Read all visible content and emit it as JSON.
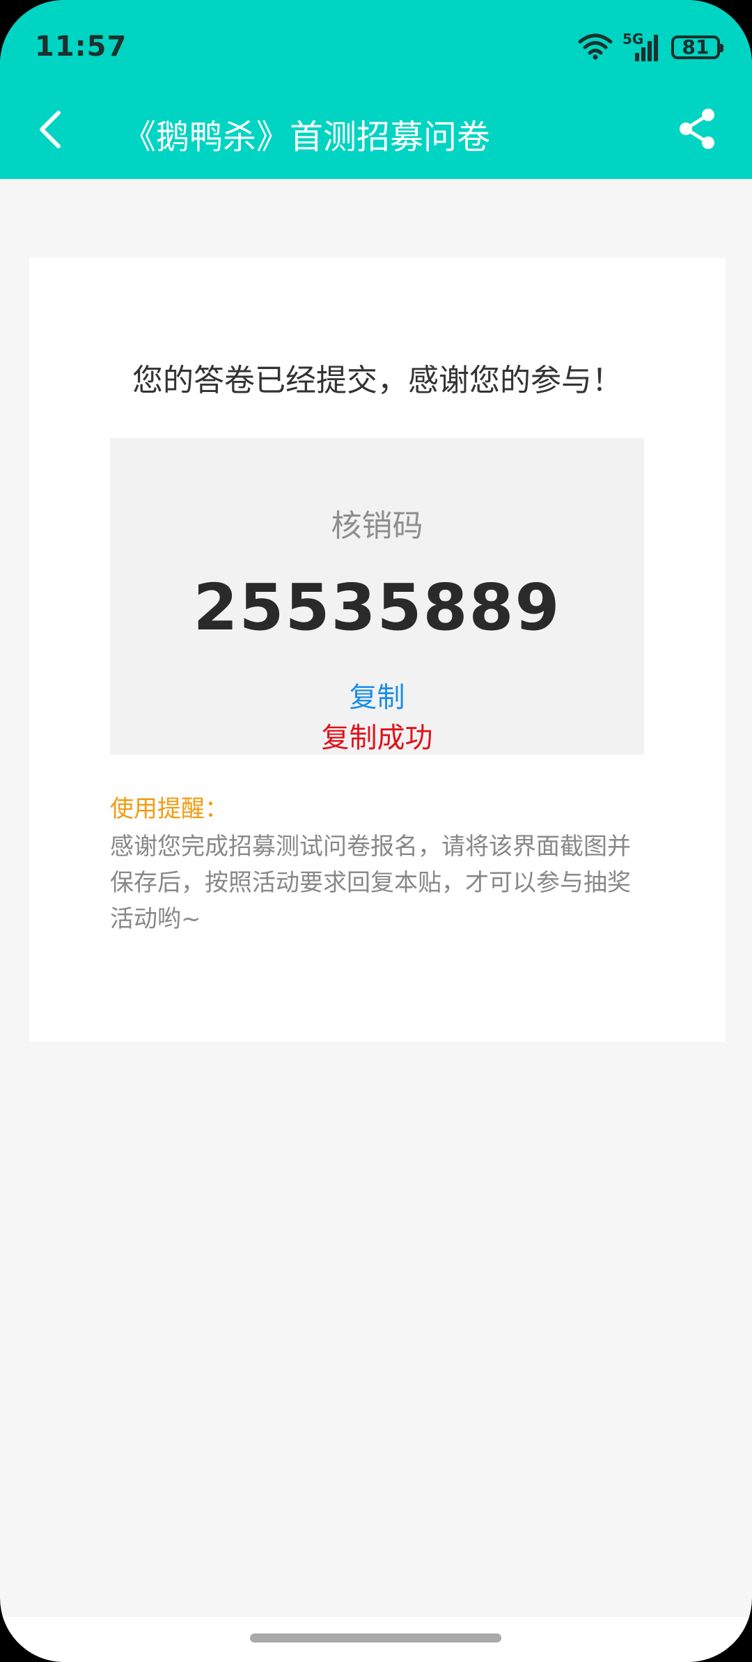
{
  "status_bar": {
    "time": "11:57",
    "network_label": "5G",
    "battery_level": "81"
  },
  "app_bar": {
    "title": "《鹅鸭杀》首测招募问卷",
    "back_icon": "chevron-left-icon",
    "share_icon": "share-icon"
  },
  "result": {
    "message": "您的答卷已经提交，感谢您的参与！",
    "code_label": "核销码",
    "code_value": "25535889",
    "copy_label": "复制",
    "copy_status": "复制成功"
  },
  "tips": {
    "title": "使用提醒：",
    "body": "感谢您完成招募测试问卷报名，请将该界面截图并保存后，按照活动要求回复本贴，才可以参与抽奖活动哟~"
  },
  "colors": {
    "header": "#00d4c2",
    "link": "#1a8ee8",
    "success": "#e0111b",
    "tips_title": "#f39a11"
  }
}
